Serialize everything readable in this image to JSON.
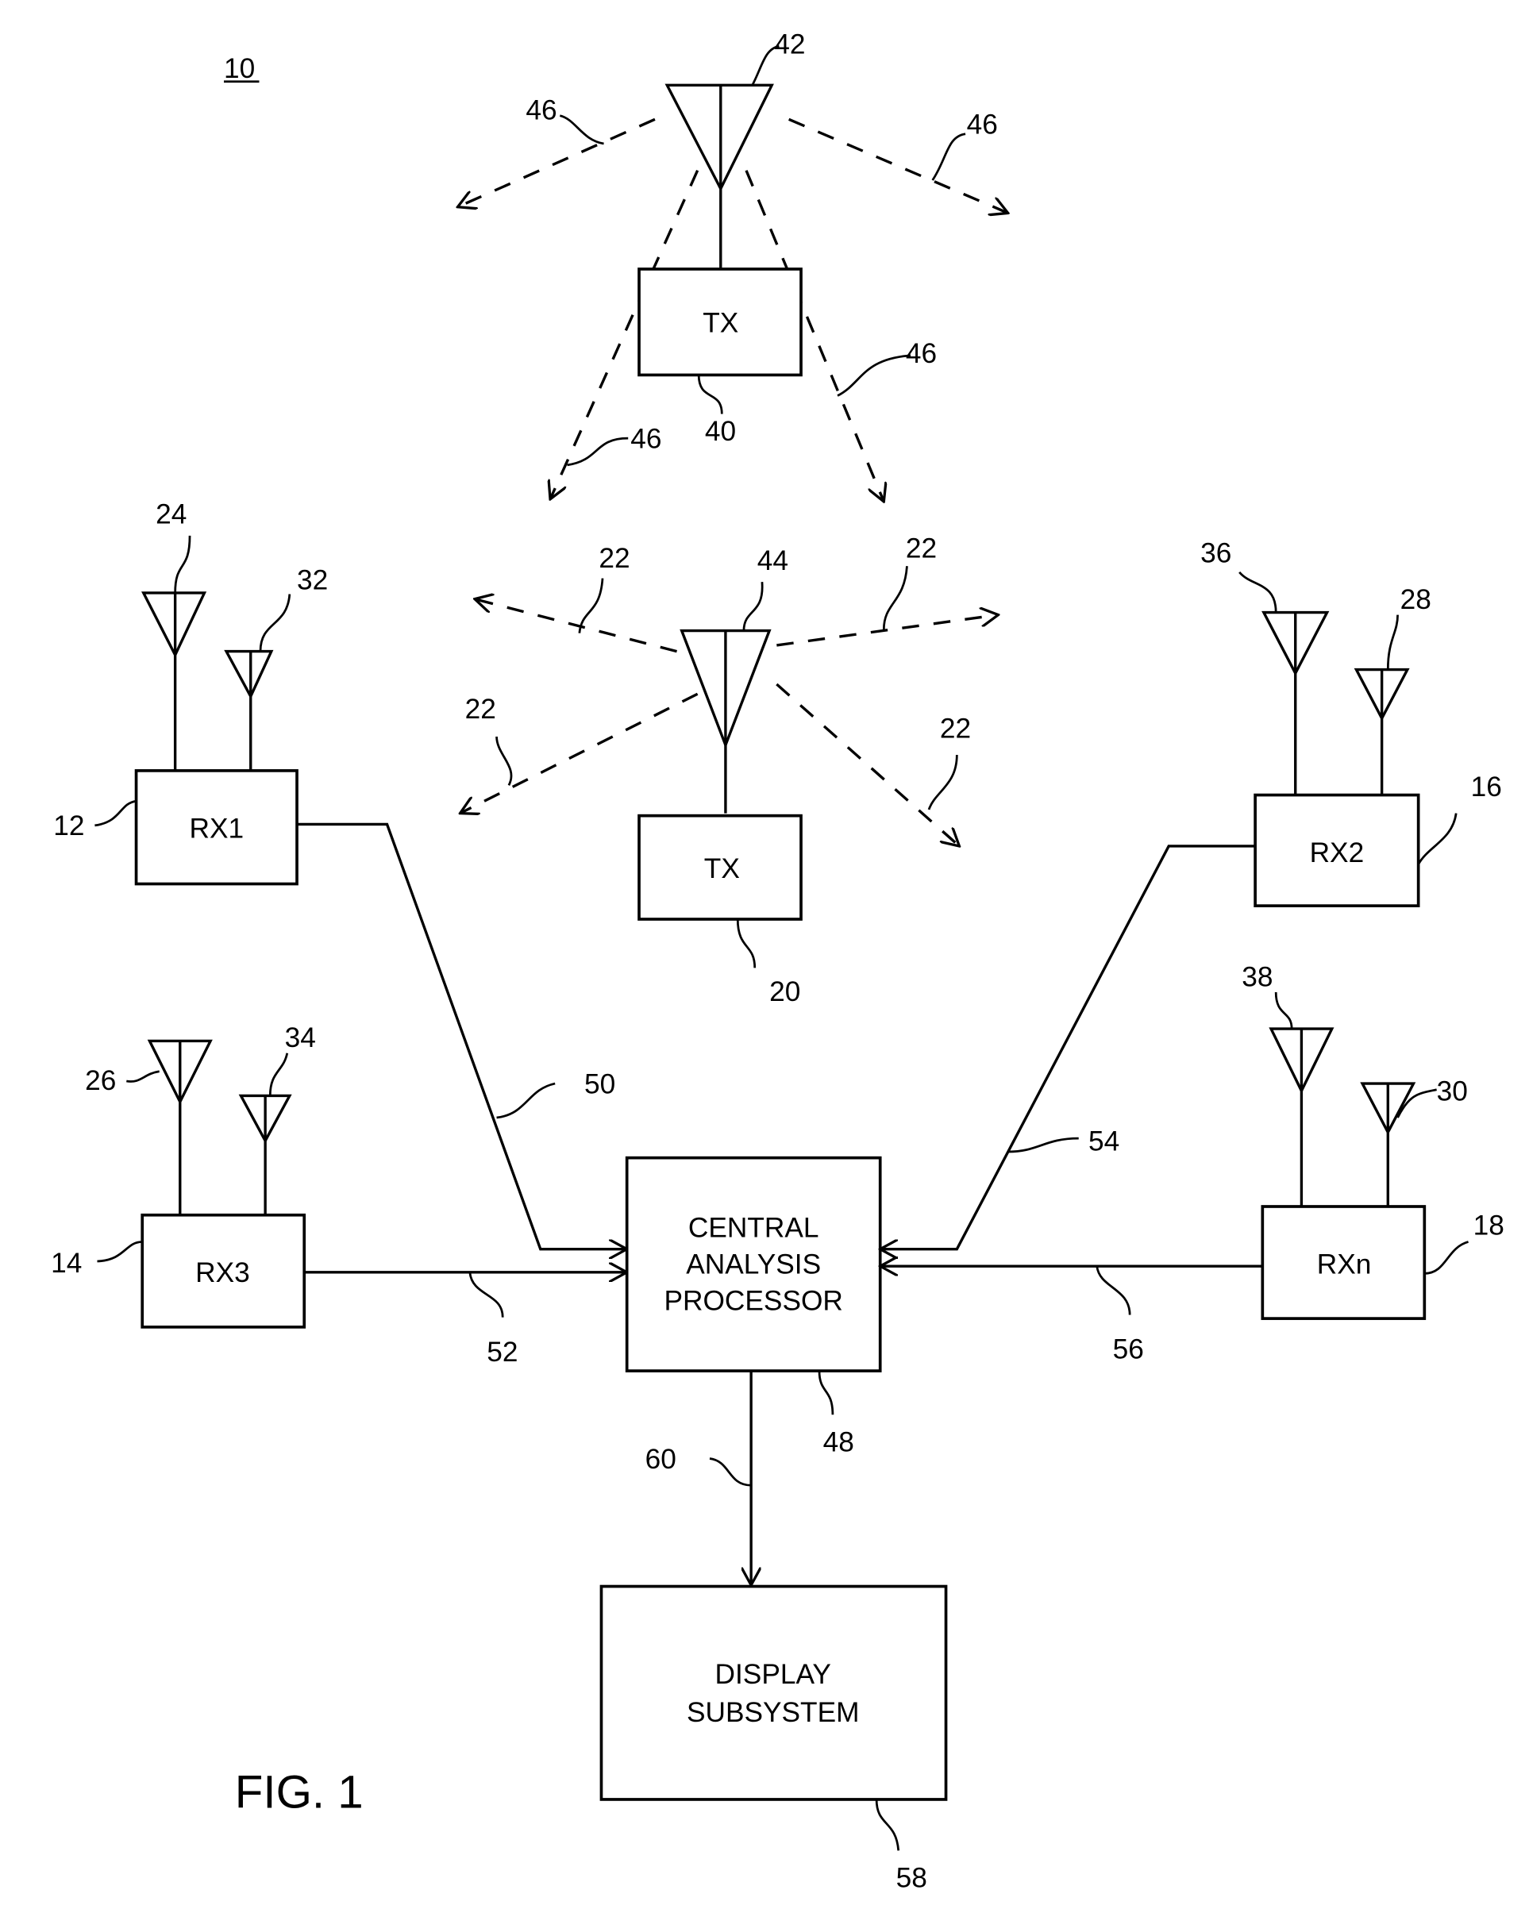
{
  "figure": {
    "title": "FIG. 1",
    "system_ref": "10"
  },
  "blocks": {
    "tx_top": {
      "label": "TX",
      "ref": "40",
      "antenna_ref": "42",
      "signal_ref": "46"
    },
    "tx_mid": {
      "label": "TX",
      "ref": "20",
      "antenna_ref": "44",
      "signal_ref": "22"
    },
    "rx1": {
      "label": "RX1",
      "ref": "12",
      "antenna_refs": [
        "24",
        "32"
      ],
      "link_ref": "50"
    },
    "rx2": {
      "label": "RX2",
      "ref": "16",
      "antenna_refs": [
        "36",
        "28"
      ],
      "link_ref": "54"
    },
    "rx3": {
      "label": "RX3",
      "ref": "14",
      "antenna_refs": [
        "26",
        "34"
      ],
      "link_ref": "52"
    },
    "rxn": {
      "label": "RXn",
      "ref": "18",
      "antenna_refs": [
        "38",
        "30"
      ],
      "link_ref": "56"
    },
    "processor": {
      "lines": [
        "CENTRAL",
        "ANALYSIS",
        "PROCESSOR"
      ],
      "ref": "48"
    },
    "display": {
      "lines": [
        "DISPLAY",
        "SUBSYSTEM"
      ],
      "ref": "58",
      "link_ref": "60"
    }
  }
}
